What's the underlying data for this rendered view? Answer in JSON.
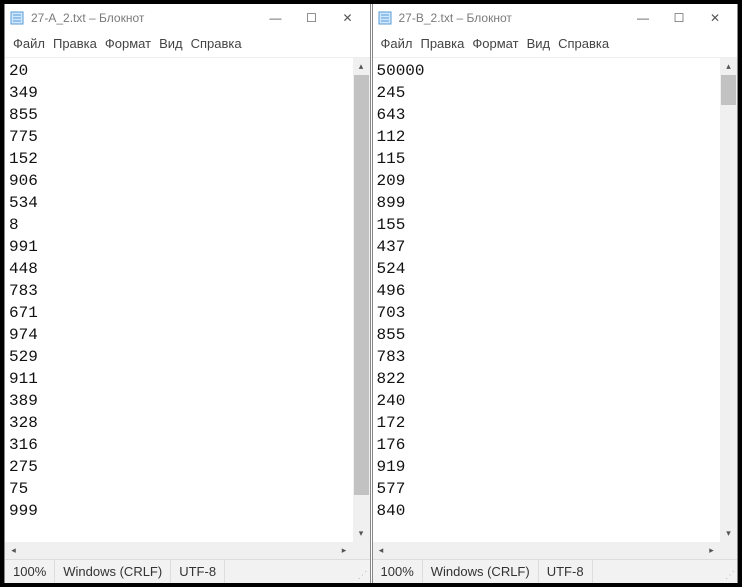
{
  "left": {
    "title": "27-A_2.txt – Блокнот",
    "menu": {
      "file": "Файл",
      "edit": "Правка",
      "format": "Формат",
      "view": "Вид",
      "help": "Справка"
    },
    "lines": [
      "20",
      "349",
      "855",
      "775",
      "152",
      "906",
      "534",
      "8",
      "991",
      "448",
      "783",
      "671",
      "974",
      "529",
      "911",
      "389",
      "328",
      "316",
      "275",
      "75",
      "999"
    ],
    "status": {
      "zoom": "100%",
      "eol": "Windows (CRLF)",
      "enc": "UTF-8"
    },
    "scroll": {
      "thumbTop": 0,
      "thumbHeight": 420
    }
  },
  "right": {
    "title": "27-B_2.txt – Блокнот",
    "menu": {
      "file": "Файл",
      "edit": "Правка",
      "format": "Формат",
      "view": "Вид",
      "help": "Справка"
    },
    "lines": [
      "50000",
      "245",
      "643",
      "112",
      "115",
      "209",
      "899",
      "155",
      "437",
      "524",
      "496",
      "703",
      "855",
      "783",
      "822",
      "240",
      "172",
      "176",
      "919",
      "577",
      "840"
    ],
    "status": {
      "zoom": "100%",
      "eol": "Windows (CRLF)",
      "enc": "UTF-8"
    },
    "scroll": {
      "thumbTop": 0,
      "thumbHeight": 30
    }
  }
}
